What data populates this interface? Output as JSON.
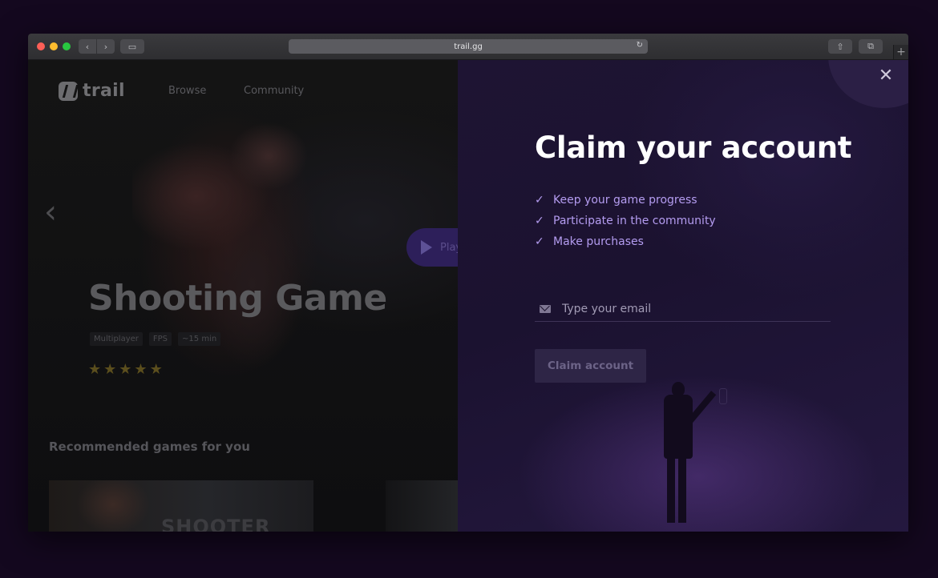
{
  "browser": {
    "url": "trail.gg",
    "back_icon": "‹",
    "forward_icon": "›",
    "sidebar_icon": "▭",
    "share_icon": "⇧",
    "tabs_icon": "⧉",
    "new_tab_icon": "+",
    "reload_icon": "↻"
  },
  "app": {
    "logo_text": "trail",
    "nav": {
      "browse": "Browse",
      "community": "Community"
    },
    "prev_icon": "‹",
    "hero": {
      "play_label": "Play",
      "title": "Shooting Game",
      "tags": [
        "Multiplayer",
        "FPS",
        "~15 min"
      ],
      "stars": [
        "★",
        "★",
        "★",
        "★",
        "★"
      ],
      "rating": 5
    },
    "recommended": {
      "title": "Recommended games for you",
      "card1_text": "SHOOTER"
    }
  },
  "modal": {
    "close_icon": "✕",
    "title": "Claim your account",
    "check_icon": "✓",
    "benefits": [
      "Keep your game progress",
      "Participate in the community",
      "Make purchases"
    ],
    "email": {
      "placeholder": "Type your email",
      "value": ""
    },
    "claim_label": "Claim account"
  },
  "colors": {
    "accent": "#b49cf0",
    "modal_bg": "#1e1433",
    "button_disabled": "#2e2546"
  }
}
